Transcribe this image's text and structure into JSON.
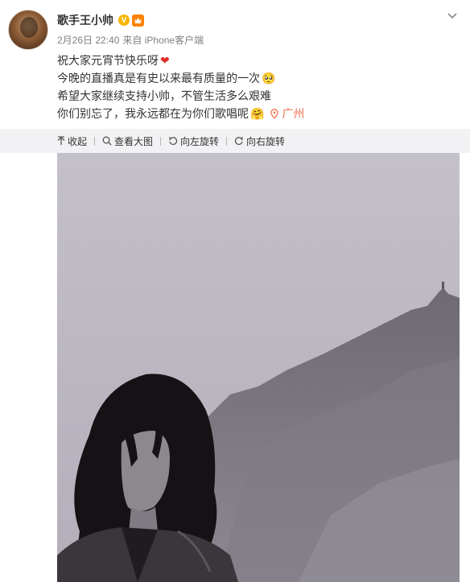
{
  "user": {
    "name": "歌手王小帅",
    "verified_badge": "V",
    "vip_badge": "vip",
    "badge_color": "#f7b500"
  },
  "meta": {
    "time": "2月26日 22:40",
    "source": "来自 iPhone客户端"
  },
  "post": {
    "line1": "祝大家元宵节快乐呀",
    "line1_emoji": "❤",
    "line2": "今晚的直播真是有史以来最有质量的一次",
    "line2_emoji": "🥺",
    "line3": "希望大家继续支持小帅，不管生活多么艰难",
    "line4": "你们别忘了，我永远都在为你们歌唱呢",
    "line4_emoji": "🤗",
    "location": "广州",
    "location_color": "#eb7350"
  },
  "toolbar": {
    "collapse": "收起",
    "view_large": "查看大图",
    "rotate_left": "向左旋转",
    "rotate_right": "向右旋转"
  },
  "icons": [
    "chevron-down-icon",
    "collapse-icon",
    "magnifier-icon",
    "rotate-left-icon",
    "rotate-right-icon",
    "location-pin-icon"
  ]
}
